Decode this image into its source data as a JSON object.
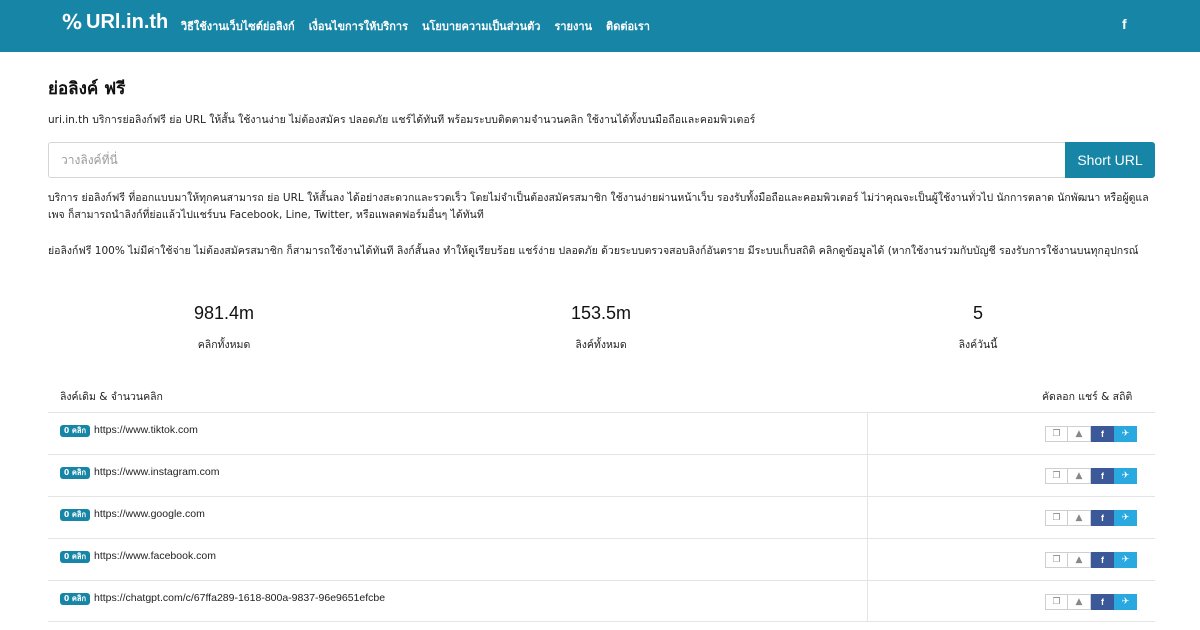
{
  "nav": {
    "brand": "URl.in.th",
    "links": [
      "วิธีใช้งานเว็บไซต์ย่อลิงก์",
      "เงื่อนไขการให้บริการ",
      "นโยบายความเป็นส่วนตัว",
      "รายงาน",
      "ติดต่อเรา"
    ],
    "facebook_glyph": "f"
  },
  "main": {
    "title": "ย่อลิงค์ ฟรี",
    "subtitle": "uri.in.th บริการย่อลิงก์ฟรี ย่อ URL ให้สั้น ใช้งานง่าย ไม่ต้องสมัคร ปลอดภัย แชร์ได้ทันที พร้อมระบบติดตามจำนวนคลิก ใช้งานได้ทั้งบนมือถือและคอมพิวเตอร์",
    "search": {
      "placeholder": "วางลิงค์ที่นี่",
      "value": "",
      "button": "Short URL"
    },
    "paragraphs": [
      "บริการ ย่อลิงก์ฟรี ที่ออกแบบมาให้ทุกคนสามารถ ย่อ URL ให้สั้นลง ได้อย่างสะดวกและรวดเร็ว โดยไม่จำเป็นต้องสมัครสมาชิก ใช้งานง่ายผ่านหน้าเว็บ รองรับทั้งมือถือและคอมพิวเตอร์ ไม่ว่าคุณจะเป็นผู้ใช้งานทั่วไป นักการตลาด นักพัฒนา หรือผู้ดูแลเพจ ก็สามารถนำลิงก์ที่ย่อแล้วไปแชร์บน Facebook, Line, Twitter, หรือแพลตฟอร์มอื่นๆ ได้ทันที",
      "ย่อลิงก์ฟรี 100% ไม่มีค่าใช้จ่าย ไม่ต้องสมัครสมาชิก ก็สามารถใช้งานได้ทันที ลิงก์สั้นลง ทำให้ดูเรียบร้อย แชร์ง่าย ปลอดภัย ด้วยระบบตรวจสอบลิงก์อันตราย มีระบบเก็บสถิติ คลิกดูข้อมูลได้ (หากใช้งานร่วมกับบัญชี รองรับการใช้งานบนทุกอุปกรณ์"
    ]
  },
  "stats": [
    {
      "value": "981.4m",
      "label": "คลิกทั้งหมด"
    },
    {
      "value": "153.5m",
      "label": "ลิงค์ทั้งหมด"
    },
    {
      "value": "5",
      "label": "ลิงค์วันนี้"
    }
  ],
  "table": {
    "header_left": "ลิงค์เดิม & จำนวนคลิก",
    "header_right": "คัดลอก แชร์ & สถิติ",
    "rows": [
      {
        "clicks": "0 คลิก",
        "url": "https://www.tiktok.com"
      },
      {
        "clicks": "0 คลิก",
        "url": "https://www.instagram.com"
      },
      {
        "clicks": "0 คลิก",
        "url": "https://www.google.com"
      },
      {
        "clicks": "0 คลิก",
        "url": "https://www.facebook.com"
      },
      {
        "clicks": "0 คลิก",
        "url": "https://chatgpt.com/c/67ffa289-1618-800a-9837-96e9651efcbe"
      }
    ],
    "action_glyphs": {
      "copy": "❐",
      "stats": "▲",
      "facebook": "f",
      "twitter": "✈"
    }
  },
  "colors": {
    "primary": "#1685a6",
    "facebook": "#3b5998",
    "twitter": "#2aa9e0"
  }
}
